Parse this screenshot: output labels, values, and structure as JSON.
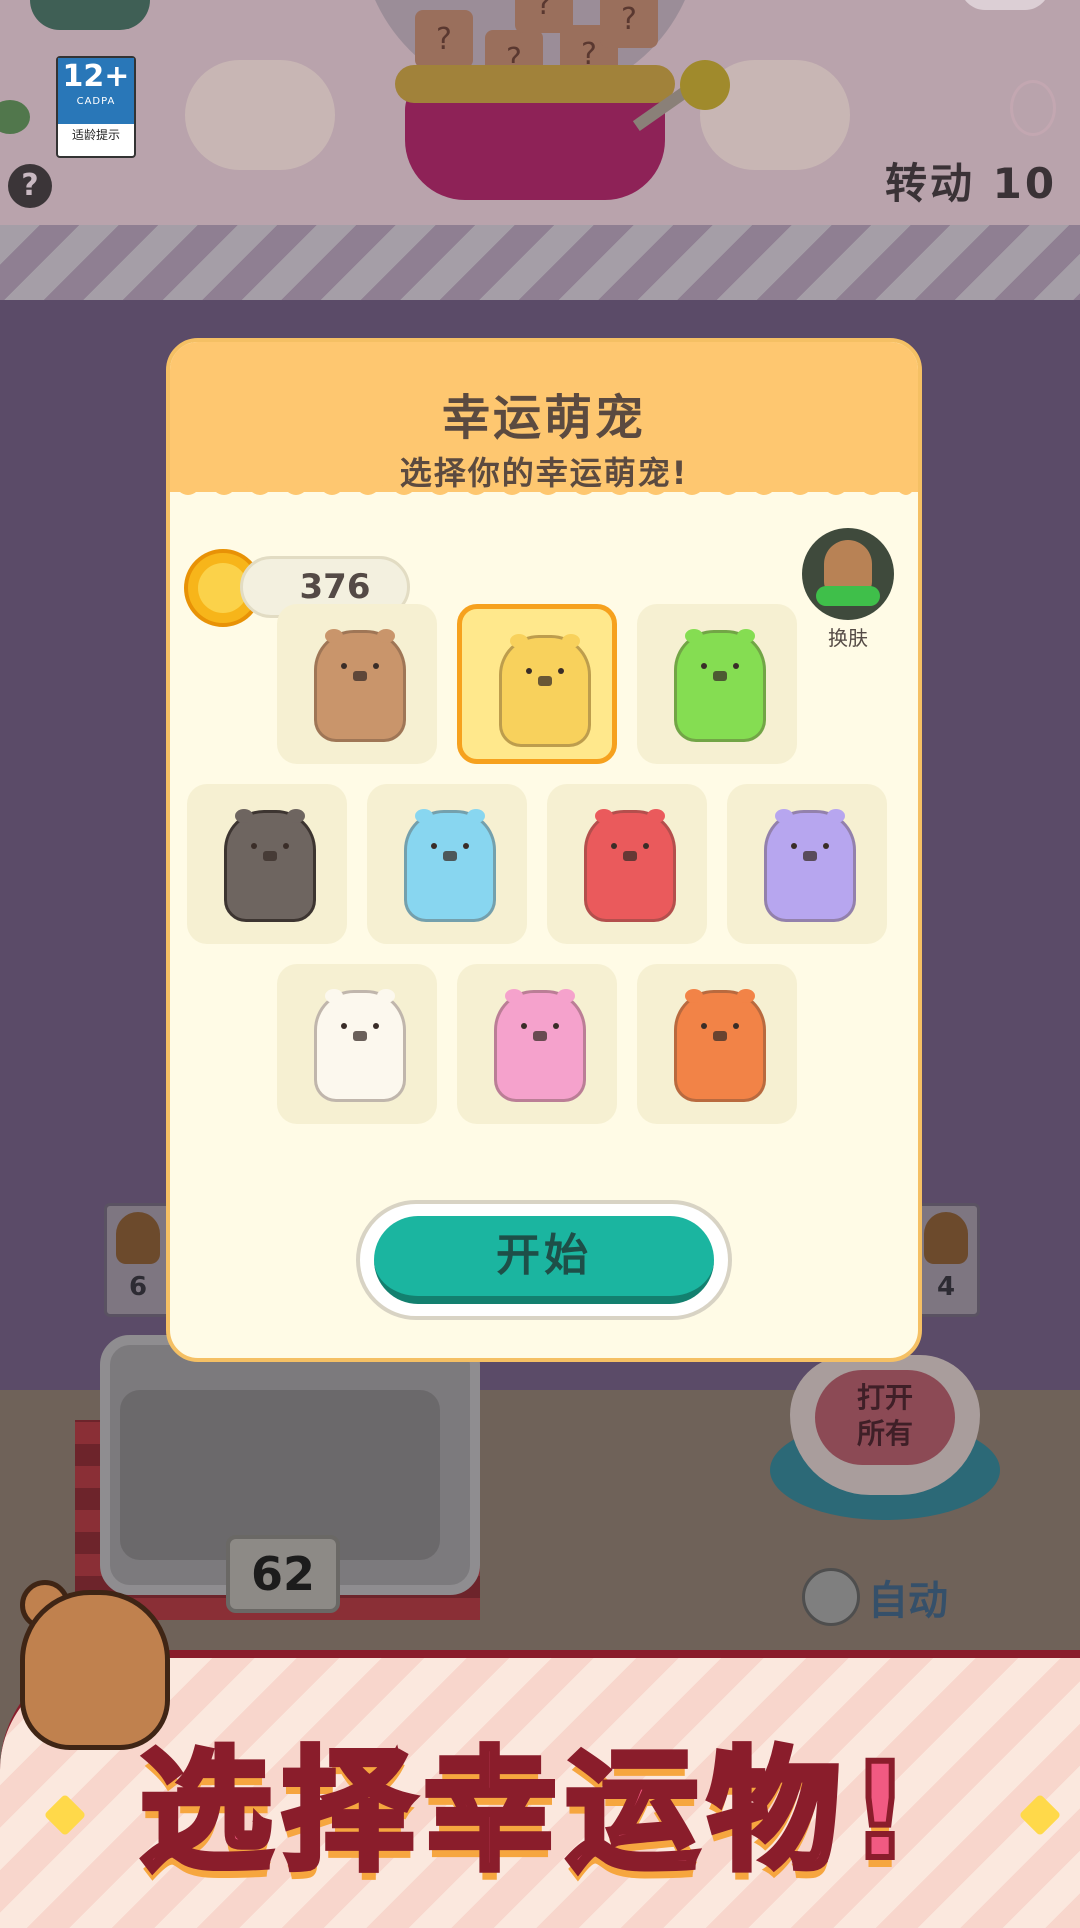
{
  "age_rating": {
    "number": "12+",
    "org": "CADPA",
    "tip": "适龄提示"
  },
  "help_icon_label": "?",
  "turn_counter": "转动 10",
  "gumball": {
    "box_labels": [
      "?",
      "?",
      "?",
      "?",
      "?"
    ]
  },
  "side_counters": {
    "left": "6",
    "right": "4"
  },
  "tray_count": "62",
  "open_all_label_line1": "打开",
  "open_all_label_line2": "所有",
  "auto_label": "自动",
  "modal": {
    "title": "幸运萌宠",
    "subtitle": "选择你的幸运萌宠!",
    "coins": "376",
    "skin_label": "换肤",
    "start_label": "开始",
    "selected_index": 1,
    "pets": [
      {
        "color": "#c9956b",
        "cheek": "#c9956b",
        "dark": false
      },
      {
        "color": "#f8d15c",
        "cheek": "#f2a2a2",
        "dark": false
      },
      {
        "color": "#85dd52",
        "cheek": "#85dd52",
        "dark": false
      },
      {
        "color": "#6e6560",
        "cheek": "#6e6560",
        "dark": true
      },
      {
        "color": "#88d6f0",
        "cheek": "#f0a5b5",
        "dark": false
      },
      {
        "color": "#ea5a5c",
        "cheek": "#f59da0",
        "dark": false
      },
      {
        "color": "#b7a6ef",
        "cheek": "#f0a8c6",
        "dark": false
      },
      {
        "color": "#fcf8ee",
        "cheek": "#f6b8b8",
        "dark": false
      },
      {
        "color": "#f5a2cc",
        "cheek": "#ee7fb0",
        "dark": false
      },
      {
        "color": "#f28347",
        "cheek": "#f28347",
        "dark": false
      }
    ]
  },
  "banner_text": "选择幸运物!",
  "colors": {
    "accent_teal": "#1bb5a0",
    "modal_header": "#fec770",
    "selected_border": "#f6a11e",
    "banner_pink": "#f15a82"
  }
}
